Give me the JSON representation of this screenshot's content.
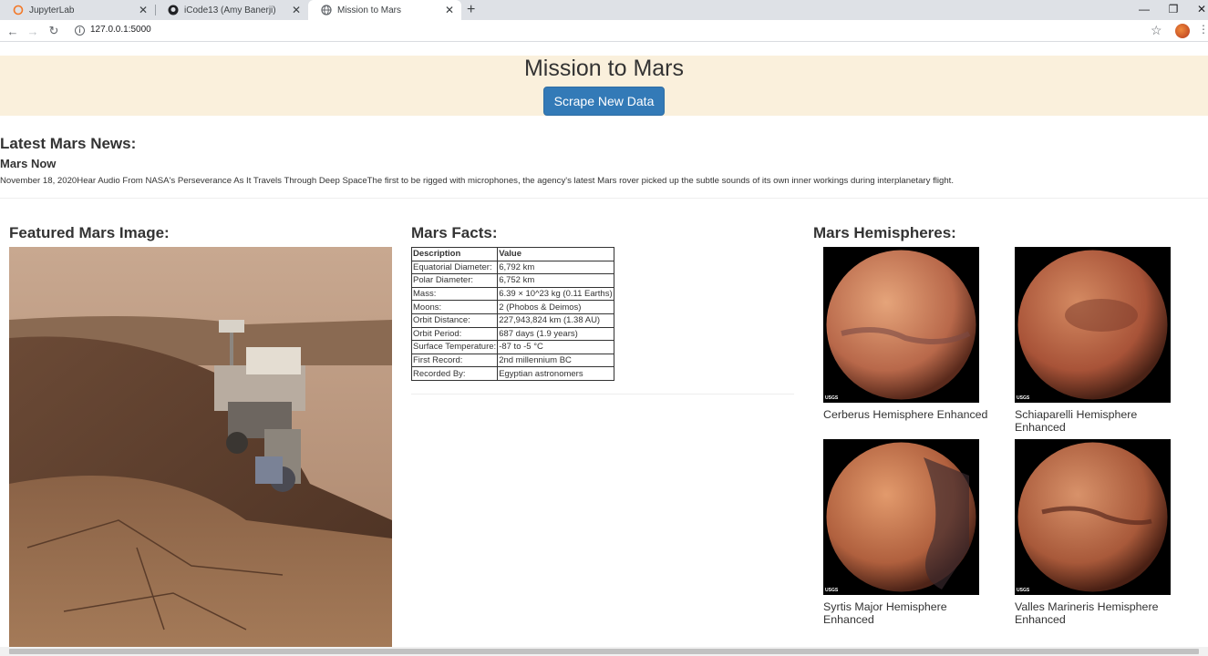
{
  "browser": {
    "tabs": [
      {
        "title": "JupyterLab",
        "icon": "jupyter-icon"
      },
      {
        "title": "iCode13 (Amy Banerji)",
        "icon": "github-icon"
      },
      {
        "title": "Mission to Mars",
        "icon": "globe-icon",
        "active": true
      }
    ],
    "url": "127.0.0.1:5000",
    "new_tab": "+",
    "close_glyph": "✕"
  },
  "header": {
    "title": "Mission to Mars",
    "scrape_button": "Scrape New Data"
  },
  "news": {
    "heading": "Latest Mars News:",
    "source": "Mars Now",
    "line": "November 18, 2020Hear Audio From NASA's Perseverance As It Travels Through Deep SpaceThe first to be rigged with microphones, the agency's latest Mars rover picked up the subtle sounds of its own inner workings during interplanetary flight."
  },
  "featured": {
    "heading": "Featured Mars Image:"
  },
  "facts": {
    "heading": "Mars Facts:",
    "columns": [
      "Description",
      "Value"
    ],
    "rows": [
      [
        "Equatorial Diameter:",
        "6,792 km"
      ],
      [
        "Polar Diameter:",
        "6,752 km"
      ],
      [
        "Mass:",
        "6.39 × 10^23 kg (0.11 Earths)"
      ],
      [
        "Moons:",
        "2 (Phobos & Deimos)"
      ],
      [
        "Orbit Distance:",
        "227,943,824 km (1.38 AU)"
      ],
      [
        "Orbit Period:",
        "687 days (1.9 years)"
      ],
      [
        "Surface Temperature:",
        "-87 to -5 °C"
      ],
      [
        "First Record:",
        "2nd millennium BC"
      ],
      [
        "Recorded By:",
        "Egyptian astronomers"
      ]
    ]
  },
  "hemispheres": {
    "heading": "Mars Hemispheres:",
    "items": [
      {
        "title": "Cerberus Hemisphere Enhanced"
      },
      {
        "title": "Schiaparelli Hemisphere Enhanced"
      },
      {
        "title": "Syrtis Major Hemisphere Enhanced"
      },
      {
        "title": "Valles Marineris Hemisphere Enhanced"
      }
    ],
    "watermark": "USGS"
  },
  "colors": {
    "jumbotron_bg": "#faf0dc",
    "button_bg": "#337ab7"
  }
}
